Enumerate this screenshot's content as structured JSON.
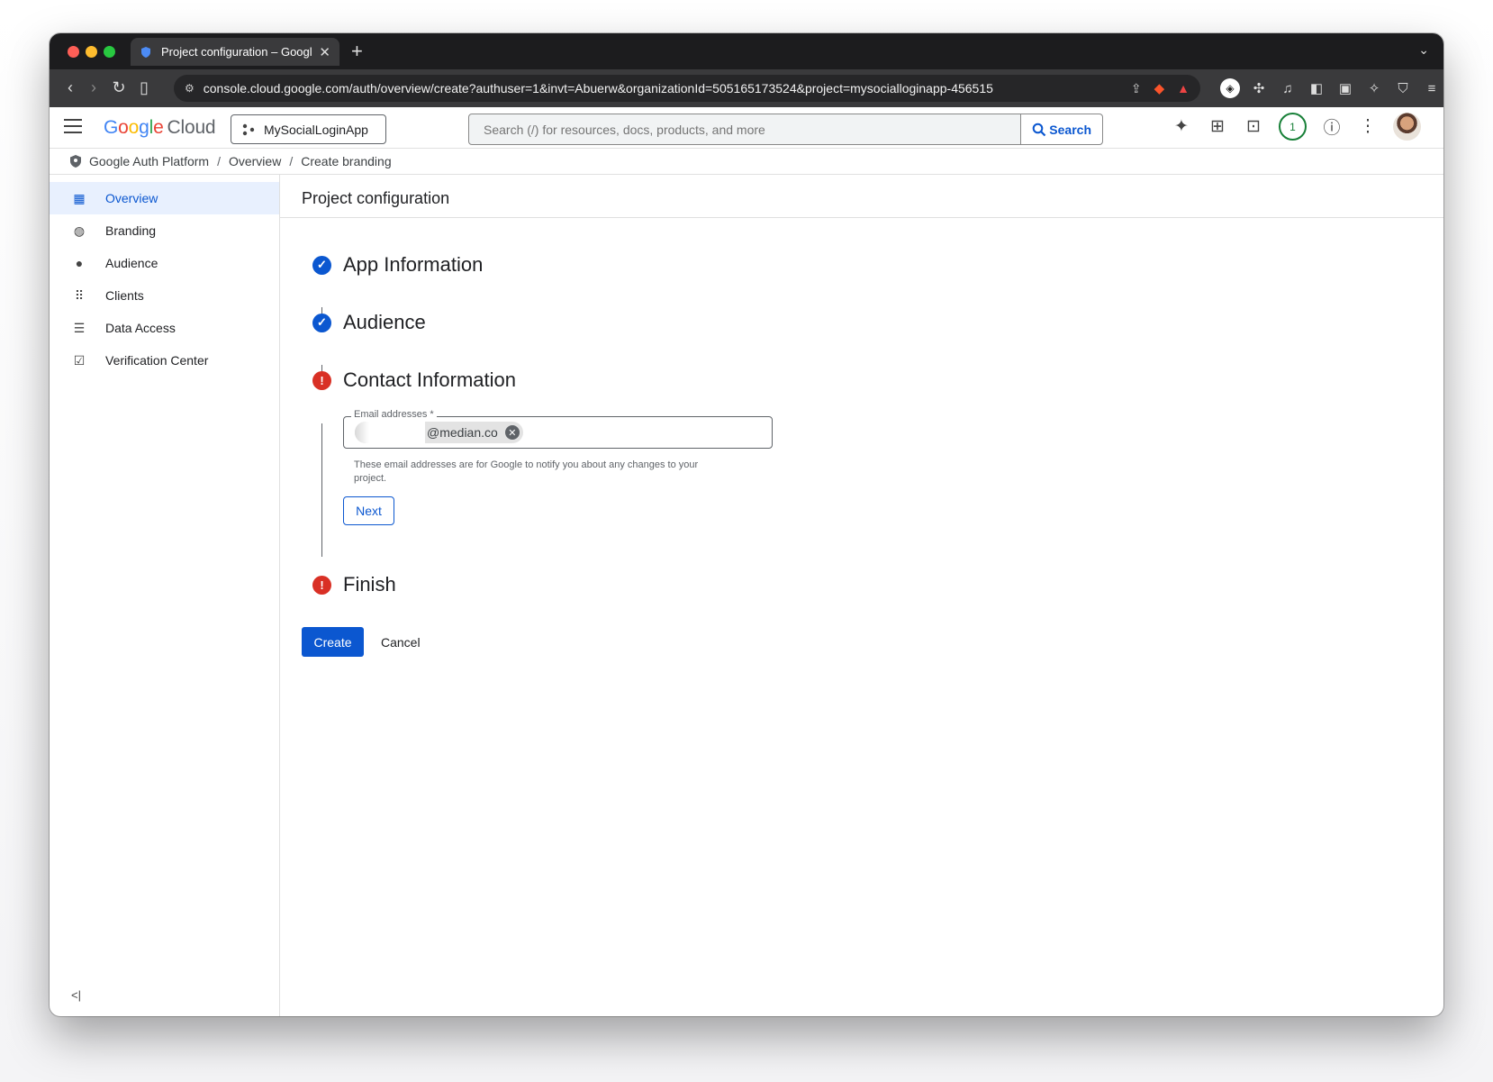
{
  "browser": {
    "tab_title": "Project configuration – Google Cloud",
    "url": "console.cloud.google.com/auth/overview/create?authuser=1&invt=Abuerw&organizationId=505165173524&project=mysocialloginapp-456515"
  },
  "header": {
    "logo_google": [
      "G",
      "o",
      "o",
      "g",
      "l",
      "e"
    ],
    "logo_cloud": "Cloud",
    "project_name": "MySocialLoginApp",
    "search_placeholder": "Search (/) for resources, docs, products, and more",
    "search_button": "Search",
    "notification_count": "1"
  },
  "breadcrumb": [
    "Google Auth Platform",
    "Overview",
    "Create branding"
  ],
  "sidebar": {
    "items": [
      {
        "label": "Overview",
        "icon": "dashboard-icon",
        "active": true
      },
      {
        "label": "Branding",
        "icon": "palette-icon"
      },
      {
        "label": "Audience",
        "icon": "person-icon"
      },
      {
        "label": "Clients",
        "icon": "grid-icon"
      },
      {
        "label": "Data Access",
        "icon": "data-settings-icon"
      },
      {
        "label": "Verification Center",
        "icon": "checkbox-icon"
      }
    ],
    "collapse_label": "<|"
  },
  "main": {
    "title": "Project configuration",
    "steps": [
      {
        "label": "App Information",
        "status": "done"
      },
      {
        "label": "Audience",
        "status": "done"
      },
      {
        "label": "Contact Information",
        "status": "error"
      },
      {
        "label": "Finish",
        "status": "error"
      }
    ],
    "email_label": "Email addresses *",
    "email_chip": "@median.co",
    "helper_text": "These email addresses are for Google to notify you about any changes to your project.",
    "next_button": "Next",
    "create_button": "Create",
    "cancel_button": "Cancel"
  },
  "colors": {
    "accent": "#0b57d0",
    "error": "#d93025",
    "active_bg": "#e8f0fe"
  }
}
